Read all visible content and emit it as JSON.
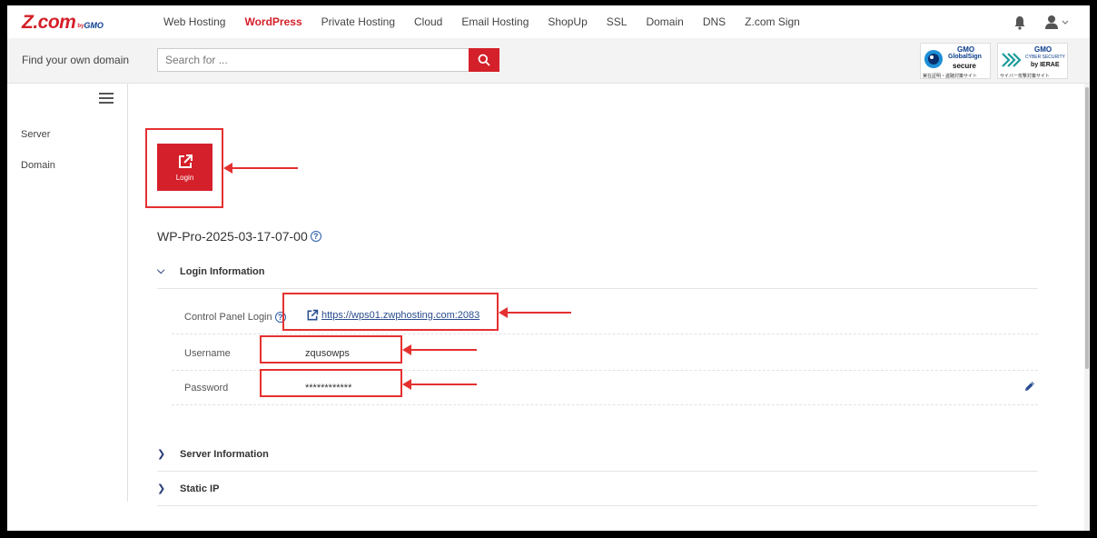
{
  "brand": {
    "logo_main": "Z.com",
    "logo_by": "by",
    "logo_gmo": "GMO"
  },
  "nav": {
    "items": [
      {
        "label": "Web Hosting",
        "active": false
      },
      {
        "label": "WordPress",
        "active": true
      },
      {
        "label": "Private Hosting",
        "active": false
      },
      {
        "label": "Cloud",
        "active": false
      },
      {
        "label": "Email Hosting",
        "active": false
      },
      {
        "label": "ShopUp",
        "active": false
      },
      {
        "label": "SSL",
        "active": false
      },
      {
        "label": "Domain",
        "active": false
      },
      {
        "label": "DNS",
        "active": false
      },
      {
        "label": "Z.com Sign",
        "active": false
      }
    ],
    "icons": [
      "bell-icon",
      "user-icon"
    ]
  },
  "search": {
    "find_label": "Find your own domain",
    "placeholder": "Search for ...",
    "value": ""
  },
  "badges": {
    "globalsign": {
      "gmo": "GMO",
      "line1": "GlobalSign",
      "line2": "secure",
      "small": "実在証明・盗聴対策サイト"
    },
    "cyber": {
      "gmo": "GMO",
      "line1": "CYBER SECURITY",
      "line2": "by IERAE",
      "small": "サイバー攻撃対策サイト"
    }
  },
  "sidebar": {
    "items": [
      {
        "label": "Server"
      },
      {
        "label": "Domain"
      }
    ]
  },
  "main": {
    "login_button": "Login",
    "title": "WP-Pro-2025-03-17-07-00",
    "sections": [
      {
        "label": "Login Information",
        "expanded": true
      },
      {
        "label": "Server Information",
        "expanded": false
      },
      {
        "label": "Static IP",
        "expanded": false
      }
    ],
    "login_info": {
      "cp_label": "Control Panel Login",
      "cp_url": "https://wps01.zwphosting.com:2083",
      "username_label": "Username",
      "username": "zqusowps",
      "password_label": "Password",
      "password": "************"
    }
  },
  "colors": {
    "accent": "#d4202a",
    "link": "#2a4d8f",
    "annotation": "#e53030"
  }
}
